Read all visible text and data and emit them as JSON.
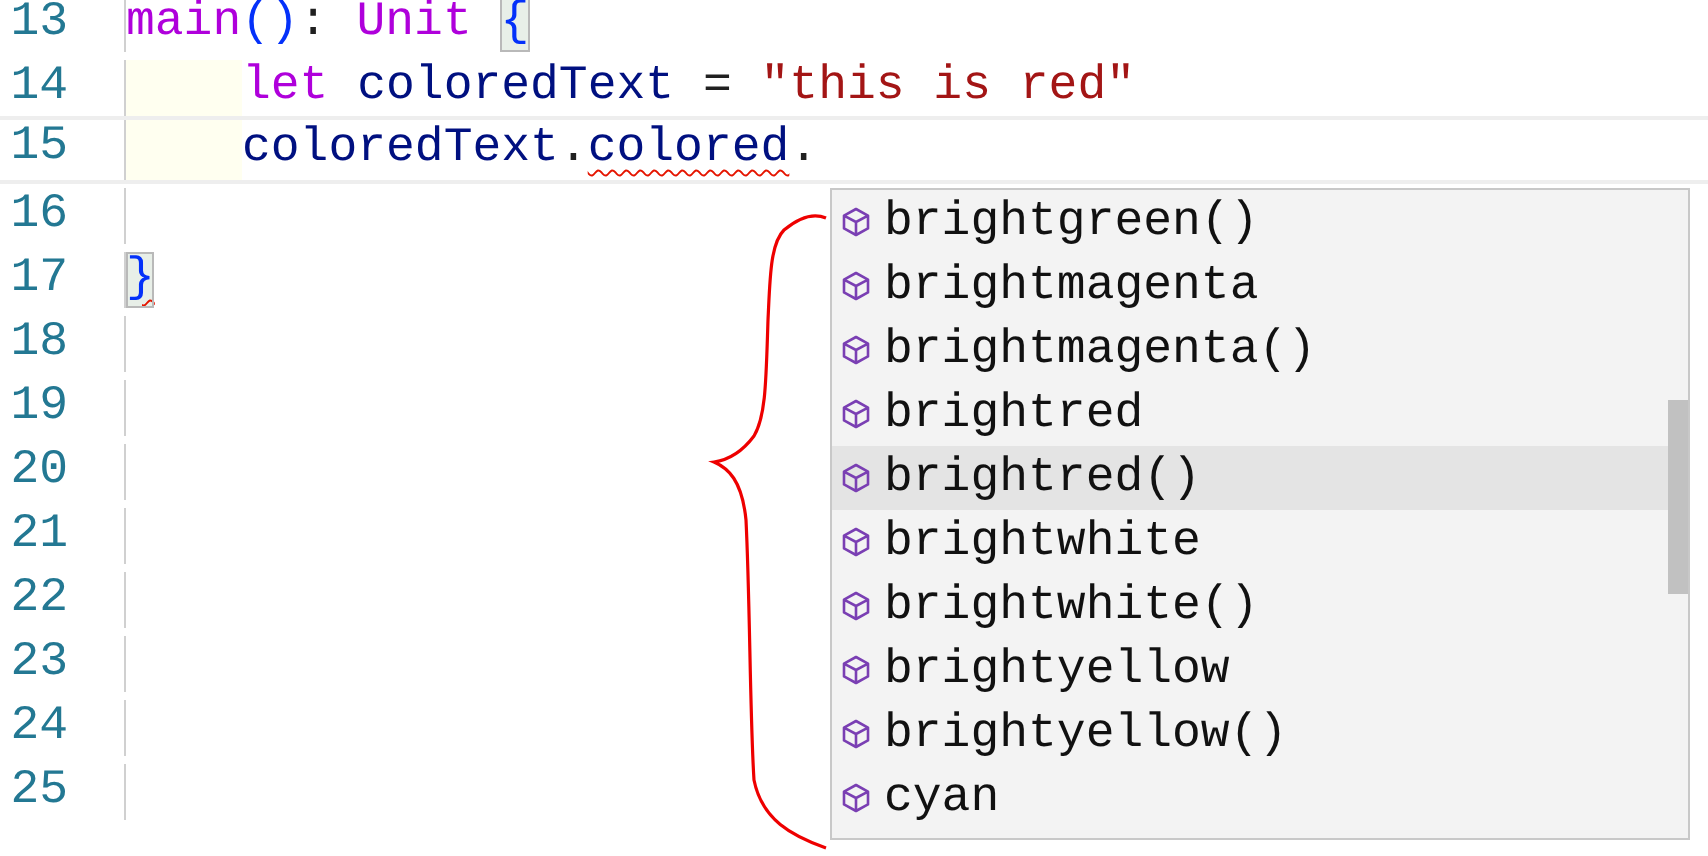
{
  "editor": {
    "lines": [
      {
        "number": "13",
        "indented": false,
        "current": false,
        "tokens": [
          {
            "text": "main",
            "kind": "keyword",
            "error": false
          },
          {
            "text": "()",
            "kind": "bracket",
            "error": false
          },
          {
            "text": ": ",
            "kind": "plain",
            "error": false
          },
          {
            "text": "Unit ",
            "kind": "keyword",
            "error": false
          },
          {
            "text": "{",
            "kind": "matched-bracket",
            "error": false
          }
        ]
      },
      {
        "number": "14",
        "indented": true,
        "current": false,
        "tokens": [
          {
            "text": "let ",
            "kind": "keyword",
            "error": false
          },
          {
            "text": "coloredText",
            "kind": "identifier",
            "error": false
          },
          {
            "text": " = ",
            "kind": "plain",
            "error": false
          },
          {
            "text": "\"this is red\"",
            "kind": "string",
            "error": false
          }
        ]
      },
      {
        "number": "15",
        "indented": true,
        "current": true,
        "tokens": [
          {
            "text": "coloredText",
            "kind": "identifier",
            "error": false
          },
          {
            "text": ".",
            "kind": "plain",
            "error": false
          },
          {
            "text": "colored",
            "kind": "identifier",
            "error": true
          },
          {
            "text": ".",
            "kind": "plain",
            "error": false
          }
        ]
      },
      {
        "number": "16",
        "indented": false,
        "current": false
      },
      {
        "number": "17",
        "indented": false,
        "current": false,
        "tokens": [
          {
            "text": "}",
            "kind": "matched-bracket",
            "error": true
          }
        ]
      },
      {
        "number": "18",
        "indented": false,
        "current": false
      },
      {
        "number": "19",
        "indented": false,
        "current": false
      },
      {
        "number": "20",
        "indented": false,
        "current": false
      },
      {
        "number": "21",
        "indented": false,
        "current": false
      },
      {
        "number": "22",
        "indented": false,
        "current": false
      },
      {
        "number": "23",
        "indented": false,
        "current": false
      },
      {
        "number": "24",
        "indented": false,
        "current": false
      },
      {
        "number": "25",
        "indented": false,
        "current": false
      }
    ]
  },
  "completion": {
    "items": [
      {
        "label": "brightgreen()",
        "selected": false
      },
      {
        "label": "brightmagenta",
        "selected": false
      },
      {
        "label": "brightmagenta()",
        "selected": false
      },
      {
        "label": "brightred",
        "selected": false
      },
      {
        "label": "brightred()",
        "selected": true
      },
      {
        "label": "brightwhite",
        "selected": false
      },
      {
        "label": "brightwhite()",
        "selected": false
      },
      {
        "label": "brightyellow",
        "selected": false
      },
      {
        "label": "brightyellow()",
        "selected": false
      },
      {
        "label": "cyan",
        "selected": false
      }
    ]
  }
}
